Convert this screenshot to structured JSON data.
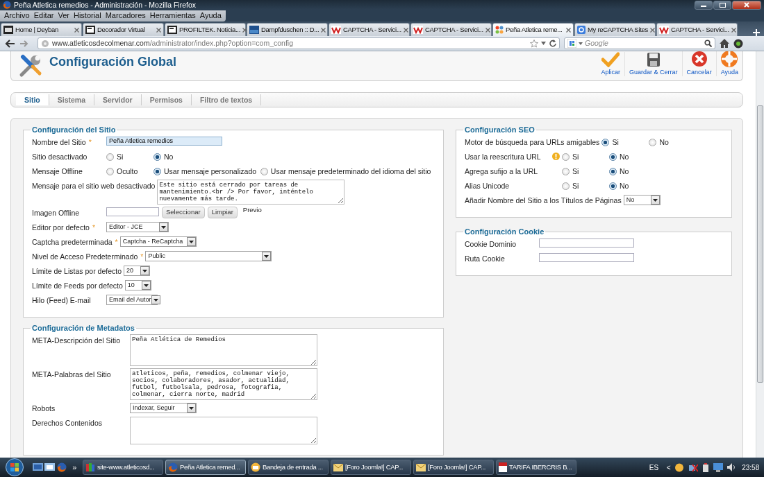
{
  "window": {
    "title": "Peña Atletica remedios - Administración - Mozilla Firefox"
  },
  "menu": [
    "Archivo",
    "Editar",
    "Ver",
    "Historial",
    "Marcadores",
    "Herramientas",
    "Ayuda"
  ],
  "browser_tabs": [
    {
      "label": "Home | Deyban",
      "kind": "logo",
      "selected": false
    },
    {
      "label": "Decorador Virtual",
      "kind": "page",
      "selected": false
    },
    {
      "label": "PROFILTEK. Noticia...",
      "kind": "page",
      "selected": false
    },
    {
      "label": "Dampfduschen :: D...",
      "kind": "blue",
      "selected": false
    },
    {
      "label": "CAPTCHA - Servici...",
      "kind": "captcha",
      "selected": false
    },
    {
      "label": "CAPTCHA - Servici...",
      "kind": "captcha",
      "selected": false
    },
    {
      "label": "Peña Atletica reme...",
      "kind": "joomla",
      "selected": true
    },
    {
      "label": "My reCAPTCHA Sites",
      "kind": "google",
      "selected": false
    },
    {
      "label": "CAPTCHA - Servici...",
      "kind": "captcha",
      "selected": false
    }
  ],
  "address": {
    "host": "www.atleticosdecolmenar.com",
    "path": "/administrator/index.php?option=com_config"
  },
  "search": {
    "placeholder": "Google"
  },
  "page": {
    "title": "Configuración Global",
    "toolbar": [
      {
        "label": "Aplicar",
        "kind": "apply"
      },
      {
        "label": "Guardar & Cerrar",
        "kind": "save"
      },
      {
        "label": "Cancelar",
        "kind": "cancel"
      },
      {
        "label": "Ayuda",
        "kind": "help"
      }
    ]
  },
  "tabs": [
    {
      "label": "Sitio",
      "selected": true
    },
    {
      "label": "Sistema",
      "selected": false
    },
    {
      "label": "Servidor",
      "selected": false
    },
    {
      "label": "Permisos",
      "selected": false
    },
    {
      "label": "Filtro de textos",
      "selected": false
    }
  ],
  "site": {
    "legend": "Configuración del Sitio",
    "fields": [
      {
        "kind": "text",
        "label": "Nombre del Sitio",
        "mark": "*",
        "value": "Peña Atletica remedios",
        "highlighted": true
      },
      {
        "kind": "radio",
        "label": "Sitio desactivado",
        "options": [
          {
            "label": "Si",
            "selected": false
          },
          {
            "label": "No",
            "selected": true
          }
        ]
      },
      {
        "kind": "radio",
        "label": "Mensaje Offline",
        "options": [
          {
            "label": "Oculto",
            "selected": false
          },
          {
            "label": "Usar mensaje personalizado",
            "selected": true
          },
          {
            "label": "Usar mensaje predeterminado del idioma del sitio",
            "selected": false
          }
        ]
      },
      {
        "kind": "textarea",
        "label": "Mensaje para el sitio web desactivado",
        "value": "Este sitio está cerrado por tareas de mantenimiento.<br /> Por favor, inténtelo nuevamente más tarde."
      },
      {
        "kind": "image",
        "label": "Imagen Offline",
        "buttons": [
          "Seleccionar",
          "Limpiar"
        ],
        "note": "Previo"
      },
      {
        "kind": "select",
        "label": "Editor por defecto",
        "mark": "*",
        "value": "Editor - JCE"
      },
      {
        "kind": "select",
        "label": "Captcha predeterminada",
        "mark": "*",
        "value": "Captcha - ReCaptcha"
      },
      {
        "kind": "select",
        "label": "Nivel de Acceso Predeterminado",
        "mark": "*",
        "value": "Public"
      },
      {
        "kind": "select",
        "label": "Límite de Listas por defecto",
        "value": "20"
      },
      {
        "kind": "select",
        "label": "Límite de Feeds por defecto",
        "value": "10"
      },
      {
        "kind": "select",
        "label": "Hilo (Feed) E-mail",
        "value": "Email del Autor"
      }
    ]
  },
  "metadata": {
    "legend": "Configuración de Metadatos",
    "fields": [
      {
        "kind": "textarea",
        "label": "META-Descripción del Sitio",
        "value": "Peña Atlética de Remedios"
      },
      {
        "kind": "textarea",
        "label": "META-Palabras del Sitio",
        "value": "atleticos, peña, remedios, colmenar viejo, socios, colaboradores, asador, actualidad, futbol, futbolsala, pedrosa, fotografia, colmenar, cierra norte, madrid"
      },
      {
        "kind": "select",
        "label": "Robots",
        "value": "Indexar, Seguir"
      },
      {
        "kind": "textarea",
        "label": "Derechos Contenidos"
      }
    ]
  },
  "seo": {
    "legend": "Configuración SEO",
    "fields": [
      {
        "kind": "radio",
        "label": "Motor de búsqueda para URLs amigables",
        "options": [
          {
            "label": "Si",
            "selected": true
          },
          {
            "label": "No",
            "selected": false
          }
        ]
      },
      {
        "kind": "radio",
        "label": "Usar la reescritura URL",
        "warning": true,
        "options": [
          {
            "label": "Si",
            "selected": false
          },
          {
            "label": "No",
            "selected": true
          }
        ]
      },
      {
        "kind": "radio",
        "label": "Agrega sufijo a la URL",
        "options": [
          {
            "label": "Si",
            "selected": false
          },
          {
            "label": "No",
            "selected": true
          }
        ]
      },
      {
        "kind": "radio",
        "label": "Alias Unicode",
        "options": [
          {
            "label": "Si",
            "selected": false
          },
          {
            "label": "No",
            "selected": true
          }
        ]
      },
      {
        "kind": "select",
        "label": "Añadir Nombre del Sitio a los Títulos de Páginas",
        "value": "No"
      }
    ]
  },
  "cookie": {
    "legend": "Configuración Cookie",
    "fields": [
      {
        "kind": "text",
        "label": "Cookie Dominio"
      },
      {
        "kind": "text",
        "label": "Ruta Cookie"
      }
    ]
  },
  "taskbar": {
    "items": [
      {
        "label": "site-www.atleticosd...",
        "kind": "files",
        "selected": false
      },
      {
        "label": "Peña Atletica remed...",
        "kind": "firefox",
        "selected": true
      },
      {
        "label": "Bandeja de entrada ...",
        "kind": "mail",
        "selected": false
      },
      {
        "label": "[Foro Joomla!] CAP...",
        "kind": "letter",
        "selected": false
      },
      {
        "label": "[Foro Joomla!] CAP...",
        "kind": "letter",
        "selected": false
      },
      {
        "label": "TARIFA IBERCRIS  B...",
        "kind": "pdf",
        "selected": false
      }
    ],
    "more": "»",
    "language": "ES",
    "tray_arrow": "<",
    "time": "23:58"
  }
}
